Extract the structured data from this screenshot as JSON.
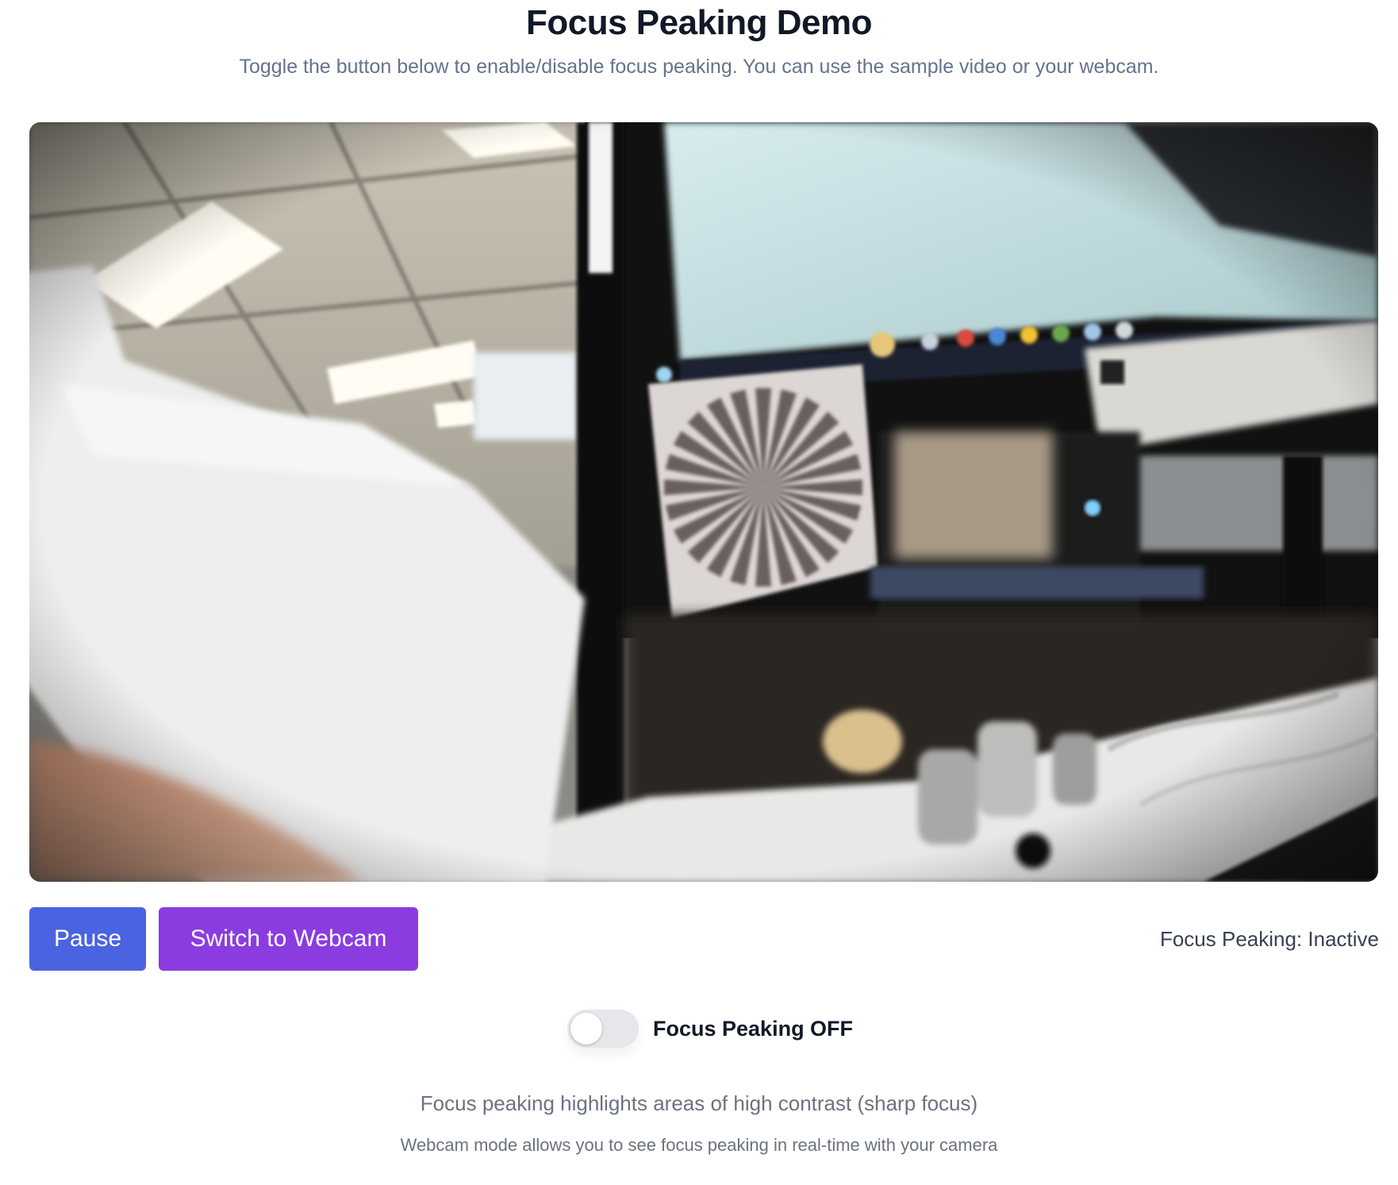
{
  "header": {
    "title": "Focus Peaking Demo",
    "subtitle": "Toggle the button below to enable/disable focus peaking. You can use the sample video or your webcam."
  },
  "video": {
    "content": "blurry office scene with focus target"
  },
  "controls": {
    "pause_label": "Pause",
    "switch_label": "Switch to Webcam",
    "status_text": "Focus Peaking: Inactive",
    "toggle_label": "Focus Peaking OFF",
    "toggle_on": false
  },
  "footer": {
    "info_primary": "Focus peaking highlights areas of high contrast (sharp focus)",
    "info_secondary": "Webcam mode allows you to see focus peaking in real-time with your camera"
  },
  "colors": {
    "pause_button": "#4a63e0",
    "switch_button": "#8a3ce0",
    "toggle_track": "#e5e7eb"
  }
}
